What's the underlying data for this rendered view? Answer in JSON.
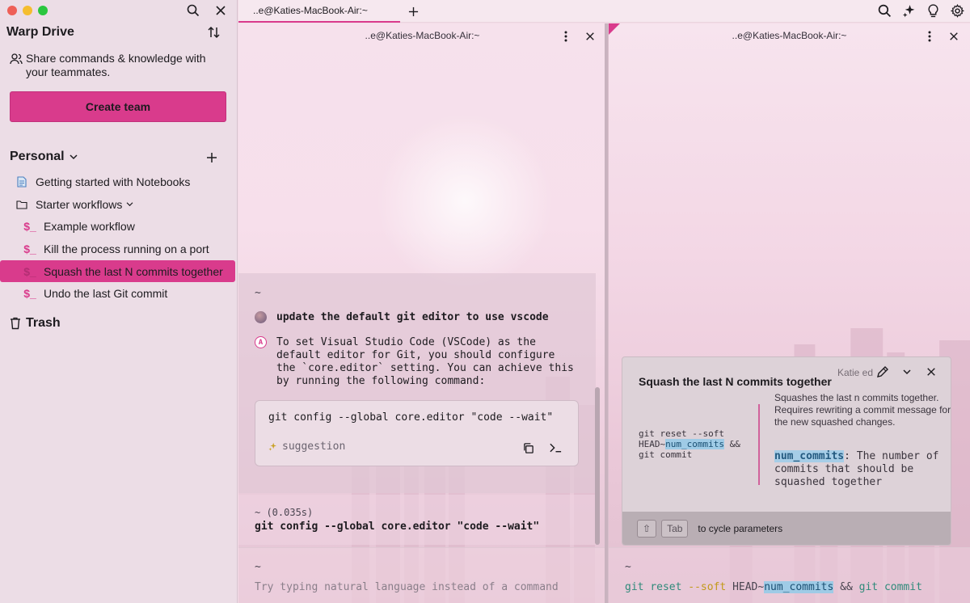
{
  "sidebar": {
    "title": "Warp Drive",
    "share_text": "Share commands & knowledge with your teammates.",
    "create_team": "Create team",
    "section": "Personal",
    "items": [
      {
        "label": "Getting started with Notebooks",
        "type": "notebook"
      },
      {
        "label": "Starter workflows",
        "type": "folder"
      },
      {
        "label": "Example workflow",
        "type": "workflow"
      },
      {
        "label": "Kill the process running on a port",
        "type": "workflow"
      },
      {
        "label": "Squash the last N commits together",
        "type": "workflow",
        "active": true
      },
      {
        "label": "Undo the last Git commit",
        "type": "workflow"
      }
    ],
    "trash": "Trash"
  },
  "tabs": {
    "active_tab": "..e@Katies-MacBook-Air:~"
  },
  "left_pane": {
    "title": "..e@Katies-MacBook-Air:~",
    "tilde": "~",
    "user_query": "update the default git editor to use vscode",
    "ai_response": "To set Visual Studio Code (VSCode) as the\ndefault editor for Git, you should configure\nthe `core.editor` setting. You can achieve this\nby running the following command:",
    "code": "git config --global core.editor \"code --wait\"",
    "suggestion_label": "suggestion",
    "run_meta": "~ (0.035s)",
    "run_cmd": "git config --global core.editor \"code --wait\"",
    "input_tilde": "~",
    "input_placeholder": "Try typing natural language instead of a command"
  },
  "right_pane": {
    "title": "..e@Katies-MacBook-Air:~",
    "workflow": {
      "title": "Squash the last N commits together",
      "author": "Katie ed",
      "cmd_part1": "git reset --soft HEAD~",
      "cmd_param": "num_commits",
      "cmd_part2": " && git commit",
      "description": "Squashes the last n commits together. Requires rewriting a commit message for the new squashed changes.",
      "param_name": "num_commits",
      "param_desc": ": The number of commits that should be squashed together",
      "shift_key": "⇧",
      "tab_key": "Tab",
      "cycle_hint": "to cycle parameters"
    },
    "input_tilde": "~",
    "input": {
      "git1": "git",
      "reset": "reset",
      "soft": "--soft",
      "head": "HEAD~",
      "param": "num_commits",
      "amp": "&&",
      "git2": "git",
      "commit": "commit"
    }
  },
  "colors": {
    "accent": "#d93b8c",
    "sidebar_bg": "#ecdde6"
  }
}
